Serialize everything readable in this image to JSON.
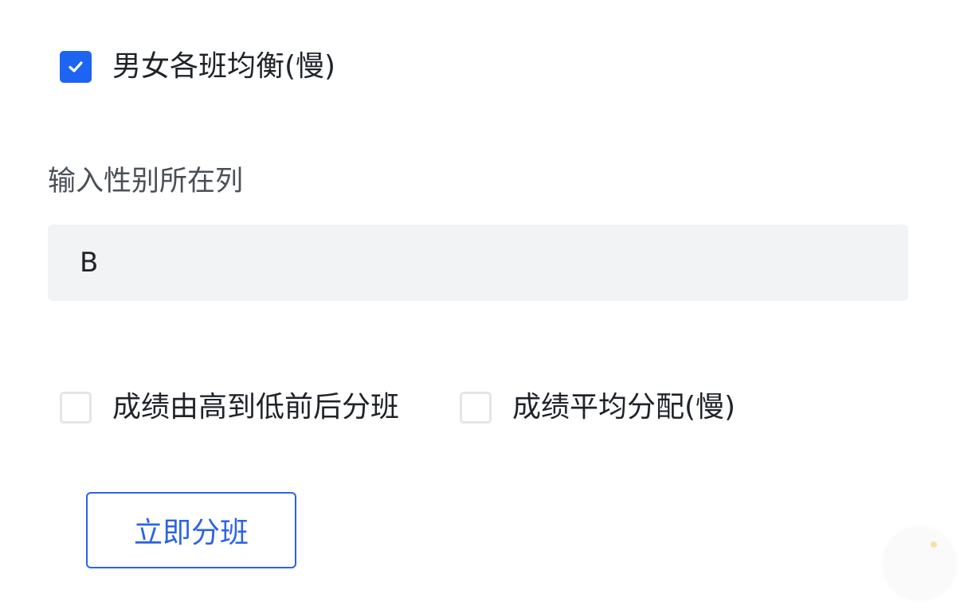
{
  "options": {
    "gender_balance": {
      "label": "男女各班均衡(慢)",
      "checked": true
    },
    "score_order": {
      "label": "成绩由高到低前后分班",
      "checked": false
    },
    "score_average": {
      "label": "成绩平均分配(慢)",
      "checked": false
    }
  },
  "gender_column": {
    "label": "输入性别所在列",
    "value": "B"
  },
  "actions": {
    "start_label": "立即分班"
  },
  "colors": {
    "accent": "#1d64f2",
    "button_text": "#2b63e6",
    "input_bg": "#f2f3f5"
  },
  "icons": {
    "checked": "check-icon"
  }
}
